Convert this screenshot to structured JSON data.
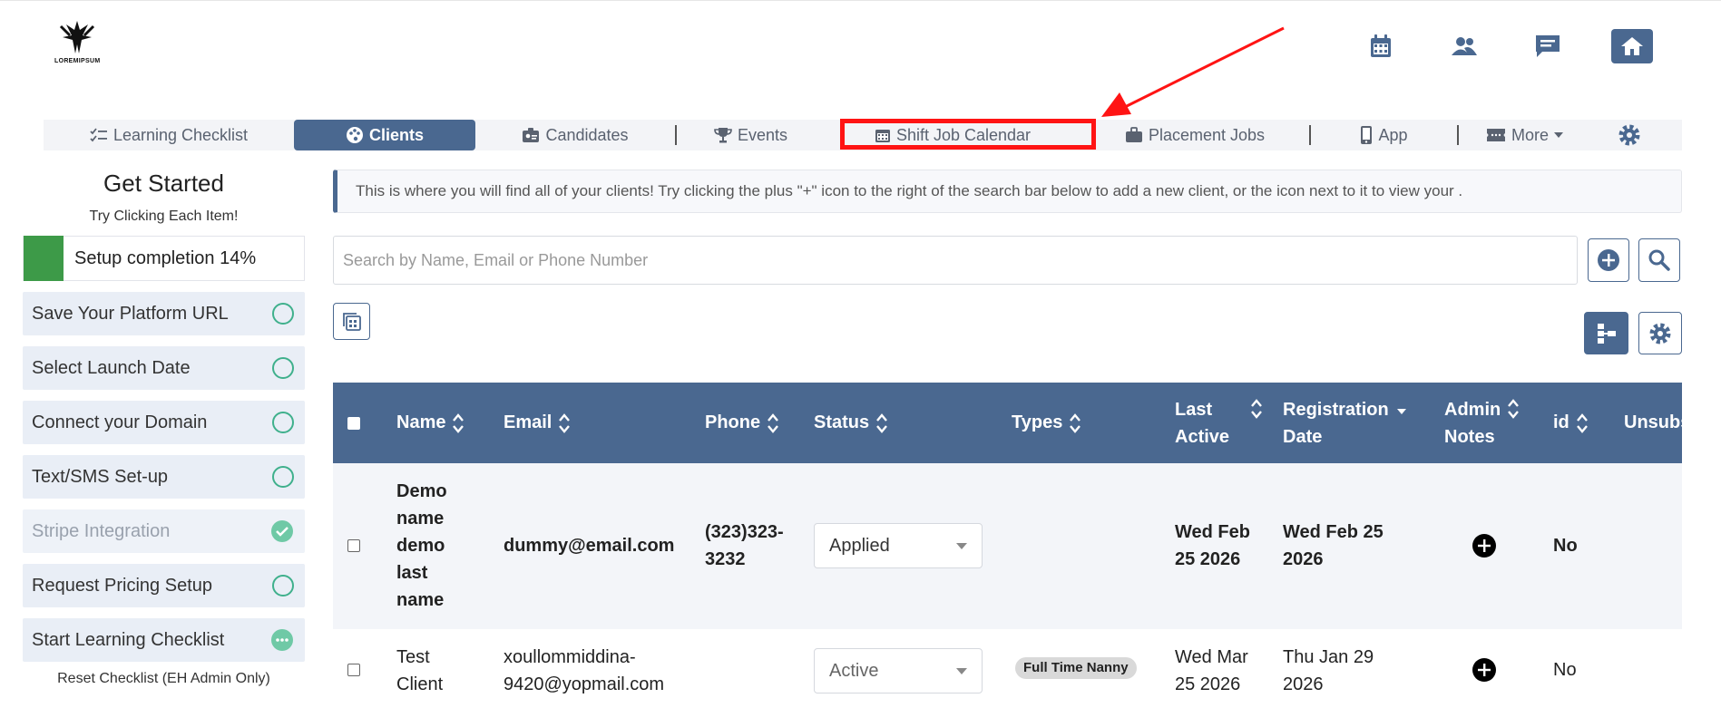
{
  "logo": {
    "text": "LOREMIPSUM"
  },
  "top_icons": [
    "calendar-icon",
    "users-icon",
    "chat-icon",
    "home-icon"
  ],
  "nav": {
    "items": [
      {
        "label": "Learning Checklist",
        "icon": "checklist-icon"
      },
      {
        "label": "Clients",
        "icon": "palette-icon",
        "active": true
      },
      {
        "label": "Candidates",
        "icon": "id-badge-icon"
      },
      {
        "label": "Events",
        "icon": "trophy-icon"
      },
      {
        "label": "Shift Job Calendar",
        "icon": "calendar-icon",
        "highlighted": true
      },
      {
        "label": "Placement Jobs",
        "icon": "briefcase-icon"
      },
      {
        "label": "App",
        "icon": "mobile-icon"
      },
      {
        "label": "More",
        "icon": "ticket-icon"
      }
    ]
  },
  "sidebar": {
    "title": "Get Started",
    "subtitle": "Try Clicking Each Item!",
    "progress_label": "Setup completion 14%",
    "progress_value": 0.14,
    "items": [
      {
        "label": "Save Your Platform URL",
        "state": "todo"
      },
      {
        "label": "Select Launch Date",
        "state": "todo"
      },
      {
        "label": "Connect your Domain",
        "state": "todo"
      },
      {
        "label": "Text/SMS Set-up",
        "state": "todo"
      },
      {
        "label": "Stripe Integration",
        "state": "done"
      },
      {
        "label": "Request Pricing Setup",
        "state": "todo"
      },
      {
        "label": "Start Learning Checklist",
        "state": "in-progress"
      }
    ],
    "reset_label": "Reset Checklist (EH Admin Only)"
  },
  "info_text": "This is where you will find all of your clients! Try clicking the plus \"+\" icon to the right of the search bar below to add a new client, or the icon next to it to view your .",
  "search": {
    "placeholder": "Search by Name, Email or Phone Number"
  },
  "table": {
    "headers": {
      "name": "Name",
      "email": "Email",
      "phone": "Phone",
      "status": "Status",
      "types": "Types",
      "last_active_1": "Last",
      "last_active_2": "Active",
      "registration_1": "Registration",
      "registration_2": "Date",
      "admin_notes_1": "Admin",
      "admin_notes_2": "Notes",
      "id": "id",
      "unsubscribed": "Unsubs"
    },
    "rows": [
      {
        "name_lines": [
          "Demo",
          "name",
          "demo",
          "last",
          "name"
        ],
        "email": "dummy@email.com",
        "phone_lines": [
          "(323)323-",
          "3232"
        ],
        "status": "Applied",
        "types": "",
        "last_active_lines": [
          "Wed Feb",
          "25 2026"
        ],
        "registration_lines": [
          "Wed Feb 25",
          "2026"
        ],
        "id": "No"
      },
      {
        "name_lines": [
          "Test",
          "Client"
        ],
        "email_lines": [
          "xoullommiddina-",
          "9420@yopmail.com"
        ],
        "phone_lines": [
          "",
          ""
        ],
        "status": "Active",
        "types": "Full Time Nanny",
        "last_active_lines": [
          "Wed Mar",
          "25 2026"
        ],
        "registration_lines": [
          "Thu Jan 29",
          "2026"
        ],
        "id": "No"
      }
    ]
  },
  "colors": {
    "primary": "#4a6890",
    "highlight": "#ff1414",
    "progress": "#3d9a48",
    "check": "#3fb08c"
  }
}
